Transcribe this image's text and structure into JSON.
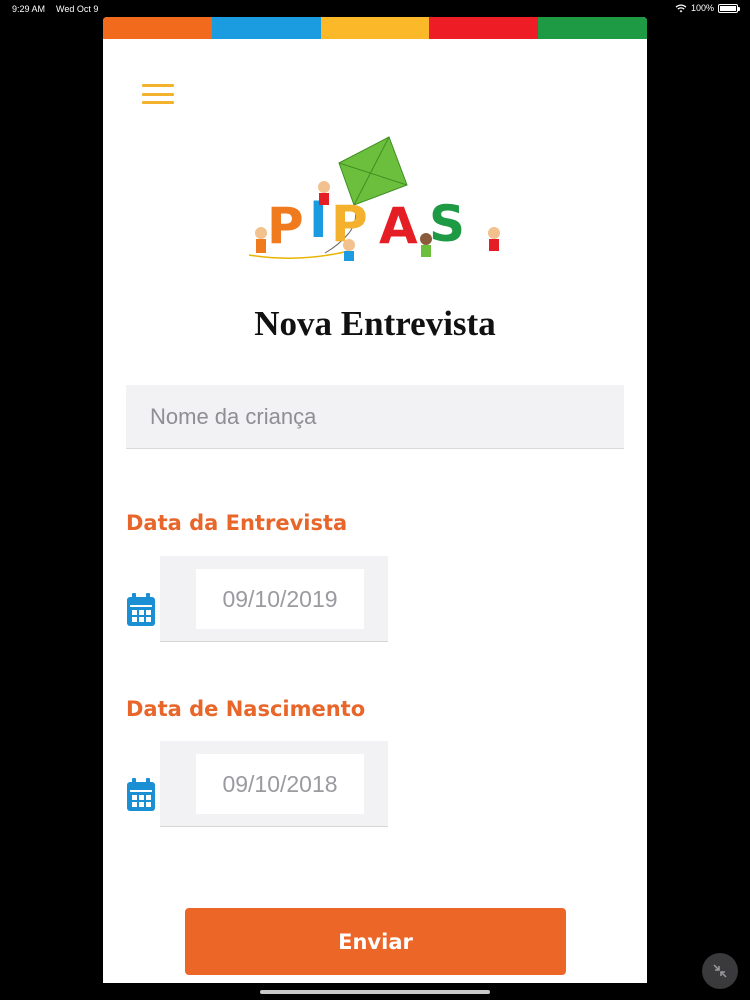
{
  "status_bar": {
    "time": "9:29 AM",
    "date": "Wed Oct 9",
    "battery": "100%",
    "battery_level": 1.0
  },
  "colors": {
    "strip": [
      "#f26a1b",
      "#1b9be0",
      "#fbb829",
      "#ee1c25",
      "#1e9a45"
    ],
    "accent": "#ec6628",
    "menu": "#f4b12e",
    "calendar_icon": "#1a8fd4"
  },
  "app": {
    "logo_text": "PIPAS",
    "title": "Nova Entrevista"
  },
  "form": {
    "name_placeholder": "Nome da criança",
    "name_value": "",
    "interview_date_label": "Data da Entrevista",
    "interview_date": "09/10/2019",
    "birth_date_label": "Data de Nascimento",
    "birth_date": "09/10/2018",
    "submit_label": "Enviar"
  },
  "icons": {
    "menu": "hamburger-menu-icon",
    "calendar": "calendar-icon",
    "wifi": "wifi-icon",
    "battery": "battery-icon",
    "collapse": "collapse-arrows-icon"
  }
}
